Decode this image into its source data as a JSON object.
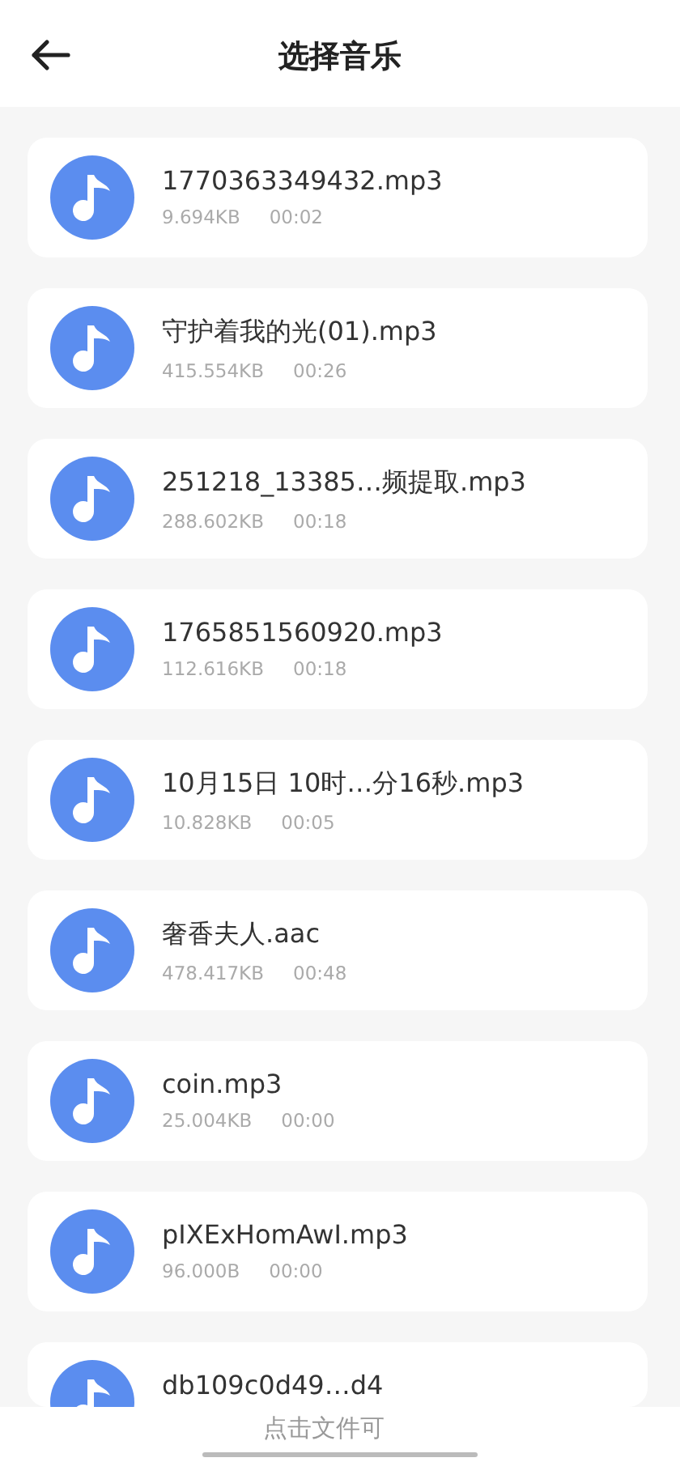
{
  "header": {
    "title": "选择音乐"
  },
  "files": [
    {
      "name": "1770363349432.mp3",
      "size": "9.694KB",
      "duration": "00:02"
    },
    {
      "name": "守护着我的光(01).mp3",
      "size": "415.554KB",
      "duration": "00:26"
    },
    {
      "name": "251218_13385…频提取.mp3",
      "size": "288.602KB",
      "duration": "00:18"
    },
    {
      "name": "1765851560920.mp3",
      "size": "112.616KB",
      "duration": "00:18"
    },
    {
      "name": "10月15日 10时…分16秒.mp3",
      "size": "10.828KB",
      "duration": "00:05"
    },
    {
      "name": "奢香夫人.aac",
      "size": "478.417KB",
      "duration": "00:48"
    },
    {
      "name": "coin.mp3",
      "size": "25.004KB",
      "duration": "00:00"
    },
    {
      "name": "pIXExHomAwI.mp3",
      "size": "96.000B",
      "duration": "00:00"
    },
    {
      "name": "db109c0d49…d4"
    }
  ],
  "hint": "点击文件可"
}
